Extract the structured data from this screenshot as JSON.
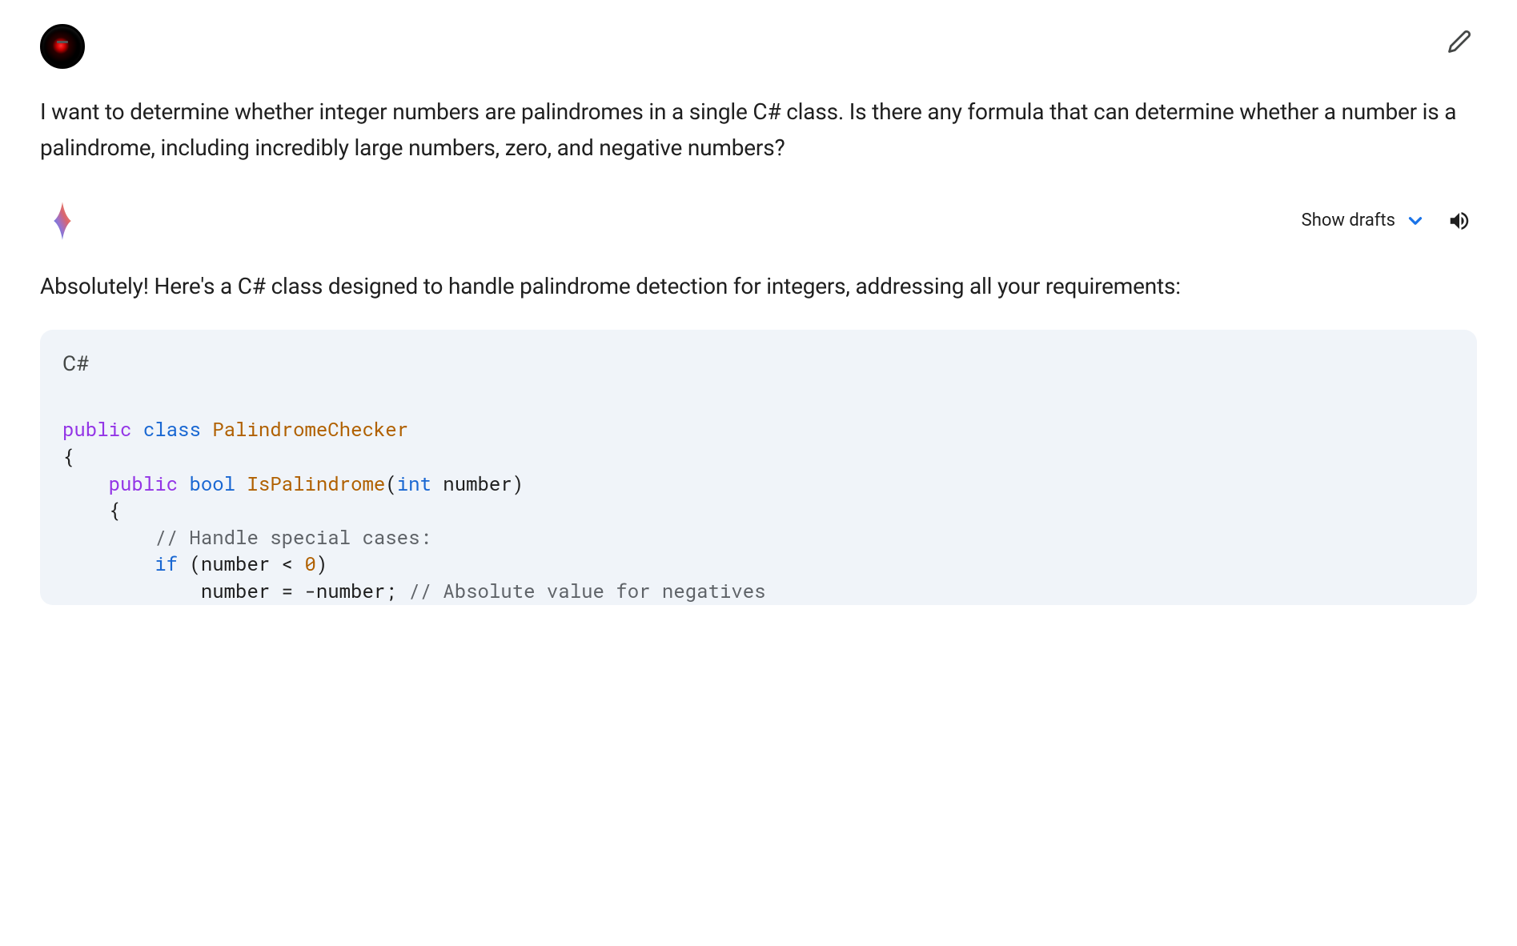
{
  "user": {
    "text": "I want to determine whether integer numbers are palindromes in a single C# class. Is there any formula that can determine whether a number is a palindrome, including incredibly large numbers, zero, and negative numbers?"
  },
  "assistant": {
    "intro_text": "Absolutely! Here's a C# class designed to handle palindrome detection for integers, addressing all your requirements:",
    "show_drafts_label": "Show drafts",
    "code": {
      "language": "C#",
      "tokens": {
        "t1": "public",
        "t2": "class",
        "t3": "PalindromeChecker",
        "t4": "{",
        "t5": "public",
        "t6": "bool",
        "t7": "IsPalindrome",
        "t8": "(",
        "t9": "int",
        "t10": " number)",
        "t11": "{",
        "t12": "// Handle special cases:",
        "t13": "if",
        "t14": " (number < ",
        "t15": "0",
        "t16": ")",
        "t17": "number = -number; ",
        "t18": "// Absolute value for negatives"
      }
    }
  }
}
